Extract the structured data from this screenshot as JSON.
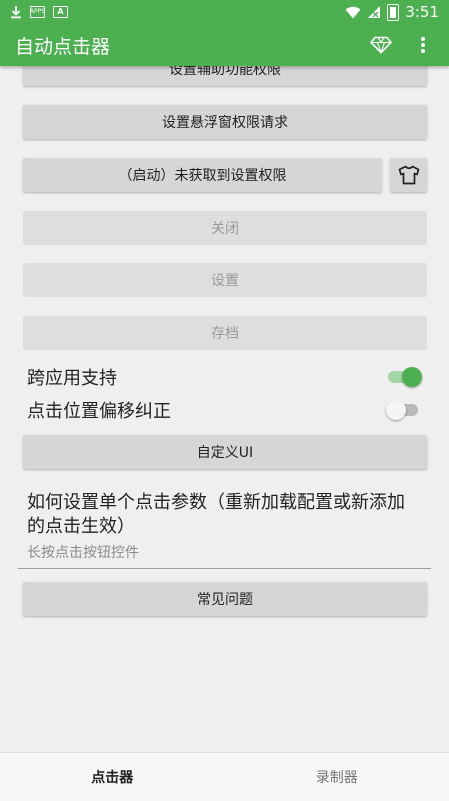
{
  "status_bar": {
    "time": "3:51",
    "badge_text": "A",
    "mini_label": "APPS",
    "icons": [
      "download-icon",
      "app-notification-icon",
      "a-notification-icon",
      "wifi-icon",
      "signal-icon",
      "battery-icon"
    ]
  },
  "app_bar": {
    "title": "自动点击器",
    "actions": [
      "diamond-icon",
      "more-vert-icon"
    ]
  },
  "colors": {
    "primary": "#4caf50",
    "background": "#efefef",
    "button": "#d6d6d6",
    "disabled_text": "#9a9a9a"
  },
  "buttons": {
    "accessibility": "设置辅助功能权限",
    "overlay": "设置悬浮窗权限请求",
    "start": "（启动）未获取到设置权限",
    "close": "关闭",
    "settings": "设置",
    "save": "存档",
    "custom_ui": "自定义UI",
    "faq": "常见问题"
  },
  "settings": {
    "cross_app": {
      "label": "跨应用支持",
      "enabled": true
    },
    "offset_correction": {
      "label": "点击位置偏移纠正",
      "enabled": false
    }
  },
  "info": {
    "title": "如何设置单个点击参数（重新加载配置或新添加的点击生效）",
    "subtitle": "长按点击按钮控件"
  },
  "bottom_nav": {
    "tabs": [
      {
        "label": "点击器",
        "active": true
      },
      {
        "label": "录制器",
        "active": false
      }
    ]
  }
}
